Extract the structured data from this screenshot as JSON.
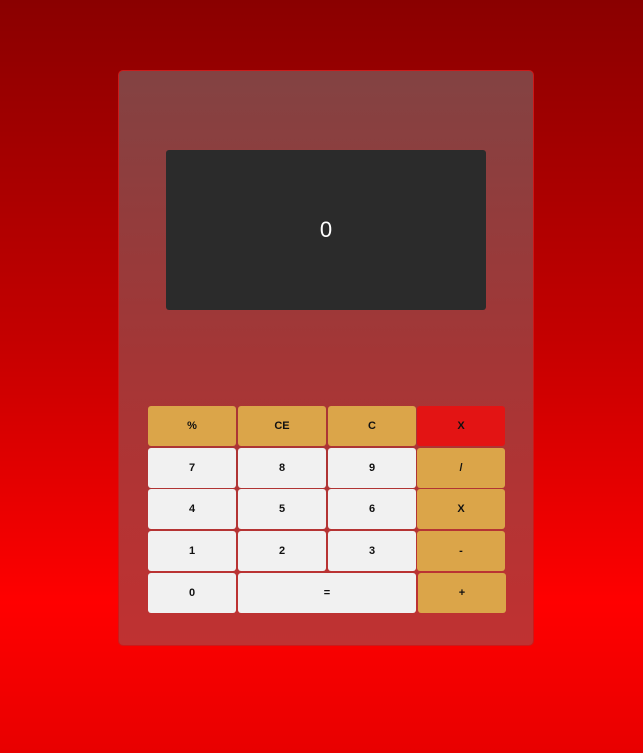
{
  "display": {
    "value": "0"
  },
  "keys": {
    "row1": [
      {
        "label": "%",
        "kind": "op"
      },
      {
        "label": "CE",
        "kind": "op"
      },
      {
        "label": "C",
        "kind": "op"
      },
      {
        "label": "X",
        "kind": "del"
      }
    ],
    "row2": [
      {
        "label": "7",
        "kind": "num"
      },
      {
        "label": "8",
        "kind": "num"
      },
      {
        "label": "9",
        "kind": "num"
      },
      {
        "label": "/",
        "kind": "op"
      }
    ],
    "row3": [
      {
        "label": "4",
        "kind": "num"
      },
      {
        "label": "5",
        "kind": "num"
      },
      {
        "label": "6",
        "kind": "num"
      },
      {
        "label": "X",
        "kind": "op"
      }
    ],
    "row4": [
      {
        "label": "1",
        "kind": "num"
      },
      {
        "label": "2",
        "kind": "num"
      },
      {
        "label": "3",
        "kind": "num"
      },
      {
        "label": "-",
        "kind": "op"
      }
    ],
    "row5": [
      {
        "label": "0",
        "kind": "num"
      },
      {
        "label": "=",
        "kind": "num"
      },
      {
        "label": "+",
        "kind": "op"
      }
    ]
  },
  "colors": {
    "number_key": "#f1f1f1",
    "operator_key": "#dba549",
    "delete_key": "#e31414",
    "display_bg": "#2b2b2b"
  }
}
